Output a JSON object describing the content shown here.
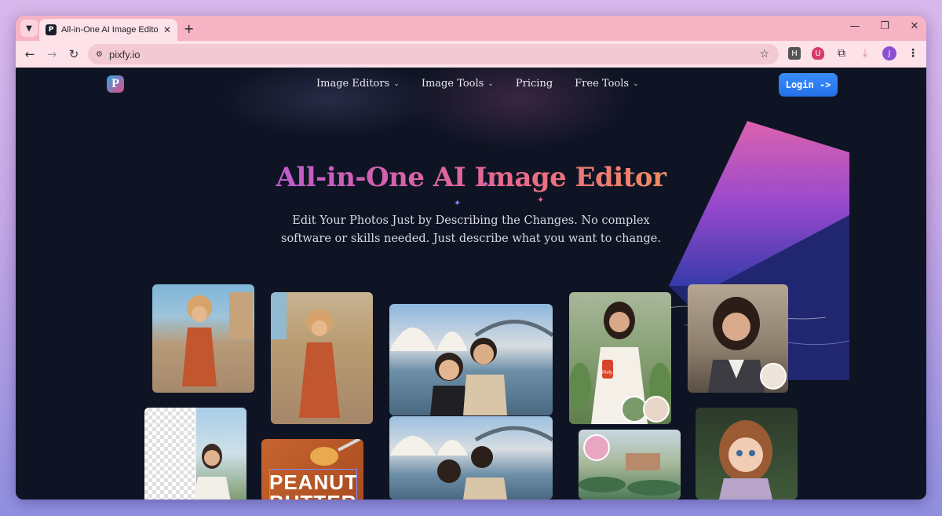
{
  "browser": {
    "tab_title": "All-in-One AI Image Editor | Edi",
    "tab_favicon": "P",
    "url": "pixfy.io",
    "new_tab_symbol": "+",
    "profile_initial": "J",
    "extension_h": "H"
  },
  "site": {
    "logo_letter": "P",
    "nav": [
      {
        "label": "Image Editors",
        "dropdown": true
      },
      {
        "label": "Image Tools",
        "dropdown": true
      },
      {
        "label": "Pricing",
        "dropdown": false
      },
      {
        "label": "Free Tools",
        "dropdown": true
      }
    ],
    "login_label": "Login ->",
    "hero_title": "All-in-One AI Image Editor",
    "hero_subtitle_line1": "Edit Your Photos Just by Describing the Changes. No complex",
    "hero_subtitle_line2": "software or skills needed. Just describe what you want to change.",
    "peanut_text_1": "PEANUT",
    "peanut_text_2": "BUTTER",
    "can_label": "Pixfy"
  },
  "colors": {
    "page_bg": "#0f1424",
    "tab_strip": "#f6b3c4",
    "toolbar": "#fde2e9",
    "login_blue": "#2f7ff2",
    "title_gradient": [
      "#8a5cf6",
      "#e86a8a",
      "#f4b24a"
    ]
  }
}
